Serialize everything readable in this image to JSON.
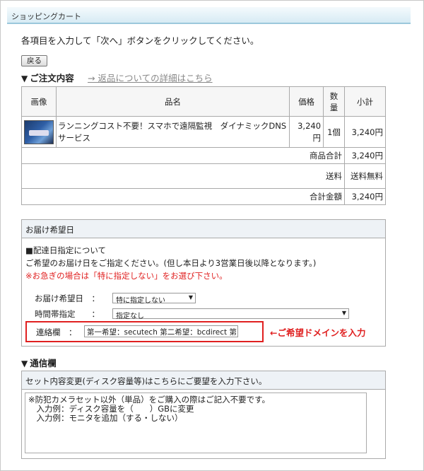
{
  "page": {
    "title": "ショッピングカート"
  },
  "intro": "各項目を入力して「次へ」ボタンをクリックしてください。",
  "back_button": "戻る",
  "order_section": {
    "heading": "ご注文内容",
    "return_link": "→ 返品についての詳細はこちら"
  },
  "cart": {
    "headers": {
      "image": "画像",
      "name": "品名",
      "price": "価格",
      "qty": "数量",
      "subtotal": "小計"
    },
    "item": {
      "name": "ランニングコスト不要！スマホで遠隔監視　ダイナミックDNSサービス",
      "price": "3,240円",
      "qty": "1個",
      "subtotal": "3,240円"
    },
    "goods_total_label": "商品合計",
    "goods_total": "3,240円",
    "shipping_label": "送料",
    "shipping": "送料無料",
    "total_label": "合計金額",
    "total": "3,240円"
  },
  "delivery": {
    "heading": "お届け希望日",
    "subheading": "■配達日指定について",
    "text": "ご希望のお届け日をご指定ください。(但し本日より3営業日後以降となります。)",
    "warning": "※お急ぎの場合は「特に指定しない」をお選び下さい。",
    "date_label": "お届け希望日　：",
    "date_value": "特に指定しない",
    "time_label": "時間帯指定　　：",
    "time_value": "指定なし",
    "contact_label": "連絡欄　：",
    "contact_value": "第一希望：secutech  第二希望：bcdirect  第",
    "annotation": "←ご希望ドメインを入力"
  },
  "comm_section": {
    "heading": "通信欄",
    "box_heading": "セット内容変更(ディスク容量等)はこちらにご要望を入力下さい。",
    "textarea_value": "※防犯カメラセット以外（単品）をご購入の際はご記入不要です。\n　入力例：ディスク容量を（　　）GBに変更\n　入力例：モニタを追加（する・しない）"
  }
}
